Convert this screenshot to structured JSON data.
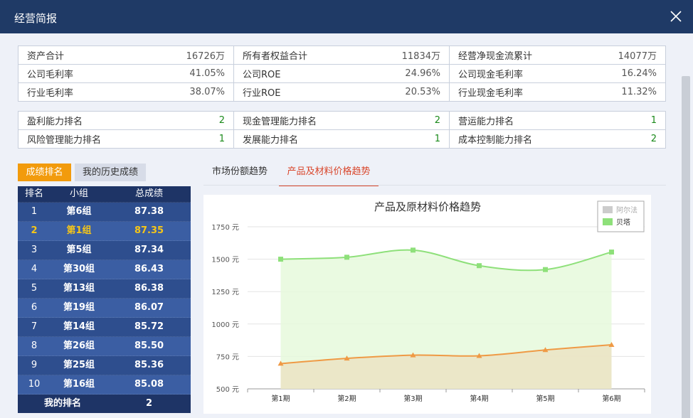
{
  "window": {
    "title": "经营简报"
  },
  "summary_rows": [
    [
      {
        "label": "资产合计",
        "value": "16726万"
      },
      {
        "label": "所有者权益合计",
        "value": "11834万"
      },
      {
        "label": "经营净现金流累计",
        "value": "14077万"
      }
    ],
    [
      {
        "label": "公司毛利率",
        "value": "41.05%"
      },
      {
        "label": "公司ROE",
        "value": "24.96%"
      },
      {
        "label": "公司现金毛利率",
        "value": "16.24%"
      }
    ],
    [
      {
        "label": "行业毛利率",
        "value": "38.07%"
      },
      {
        "label": "行业ROE",
        "value": "20.53%"
      },
      {
        "label": "行业现金毛利率",
        "value": "11.32%"
      }
    ]
  ],
  "ability_rows": [
    [
      {
        "label": "盈利能力排名",
        "value": "2"
      },
      {
        "label": "现金管理能力排名",
        "value": "2"
      },
      {
        "label": "营运能力排名",
        "value": "1"
      }
    ],
    [
      {
        "label": "风险管理能力排名",
        "value": "1"
      },
      {
        "label": "发展能力排名",
        "value": "1"
      },
      {
        "label": "成本控制能力排名",
        "value": "2"
      }
    ]
  ],
  "left_tabs": {
    "ranking": "成绩排名",
    "history": "我的历史成绩"
  },
  "ranking": {
    "headers": [
      "排名",
      "小组",
      "总成绩"
    ],
    "rows": [
      {
        "rank": "1",
        "group": "第6组",
        "score": "87.38"
      },
      {
        "rank": "2",
        "group": "第1组",
        "score": "87.35"
      },
      {
        "rank": "3",
        "group": "第5组",
        "score": "87.34"
      },
      {
        "rank": "4",
        "group": "第30组",
        "score": "86.43"
      },
      {
        "rank": "5",
        "group": "第13组",
        "score": "86.38"
      },
      {
        "rank": "6",
        "group": "第19组",
        "score": "86.07"
      },
      {
        "rank": "7",
        "group": "第14组",
        "score": "85.72"
      },
      {
        "rank": "8",
        "group": "第26组",
        "score": "85.50"
      },
      {
        "rank": "9",
        "group": "第25组",
        "score": "85.36"
      },
      {
        "rank": "10",
        "group": "第16组",
        "score": "85.08"
      }
    ],
    "highlight_index": 1,
    "my_rank_label": "我的排名",
    "my_rank_value": "2"
  },
  "chart_tabs": {
    "market": "市场份额趋势",
    "price": "产品及材料价格趋势"
  },
  "chart_data": {
    "type": "area",
    "title": "产品及原材料价格趋势",
    "categories": [
      "第1期",
      "第2期",
      "第3期",
      "第4期",
      "第5期",
      "第6期"
    ],
    "y_ticks": [
      "500 元",
      "750 元",
      "1000 元",
      "1250 元",
      "1500 元",
      "1750 元"
    ],
    "ylim": [
      500,
      1750
    ],
    "grid": true,
    "legend_position": "top-right",
    "series": [
      {
        "name": "阿尔法",
        "values": [],
        "color": "#cccccc",
        "disabled": true
      },
      {
        "name": "贝塔",
        "values": [
          1500,
          1515,
          1570,
          1450,
          1420,
          1555
        ],
        "color": "#8ee07a",
        "fill": "#e6f9dc"
      },
      {
        "name": "",
        "values": [
          695,
          735,
          760,
          755,
          800,
          840
        ],
        "color": "#ef9a45",
        "fill": "#ebe3c3"
      }
    ]
  },
  "colors": {
    "header": "#1f3a66",
    "accent_tab": "#f29b0c",
    "highlight": "#f5c518"
  }
}
